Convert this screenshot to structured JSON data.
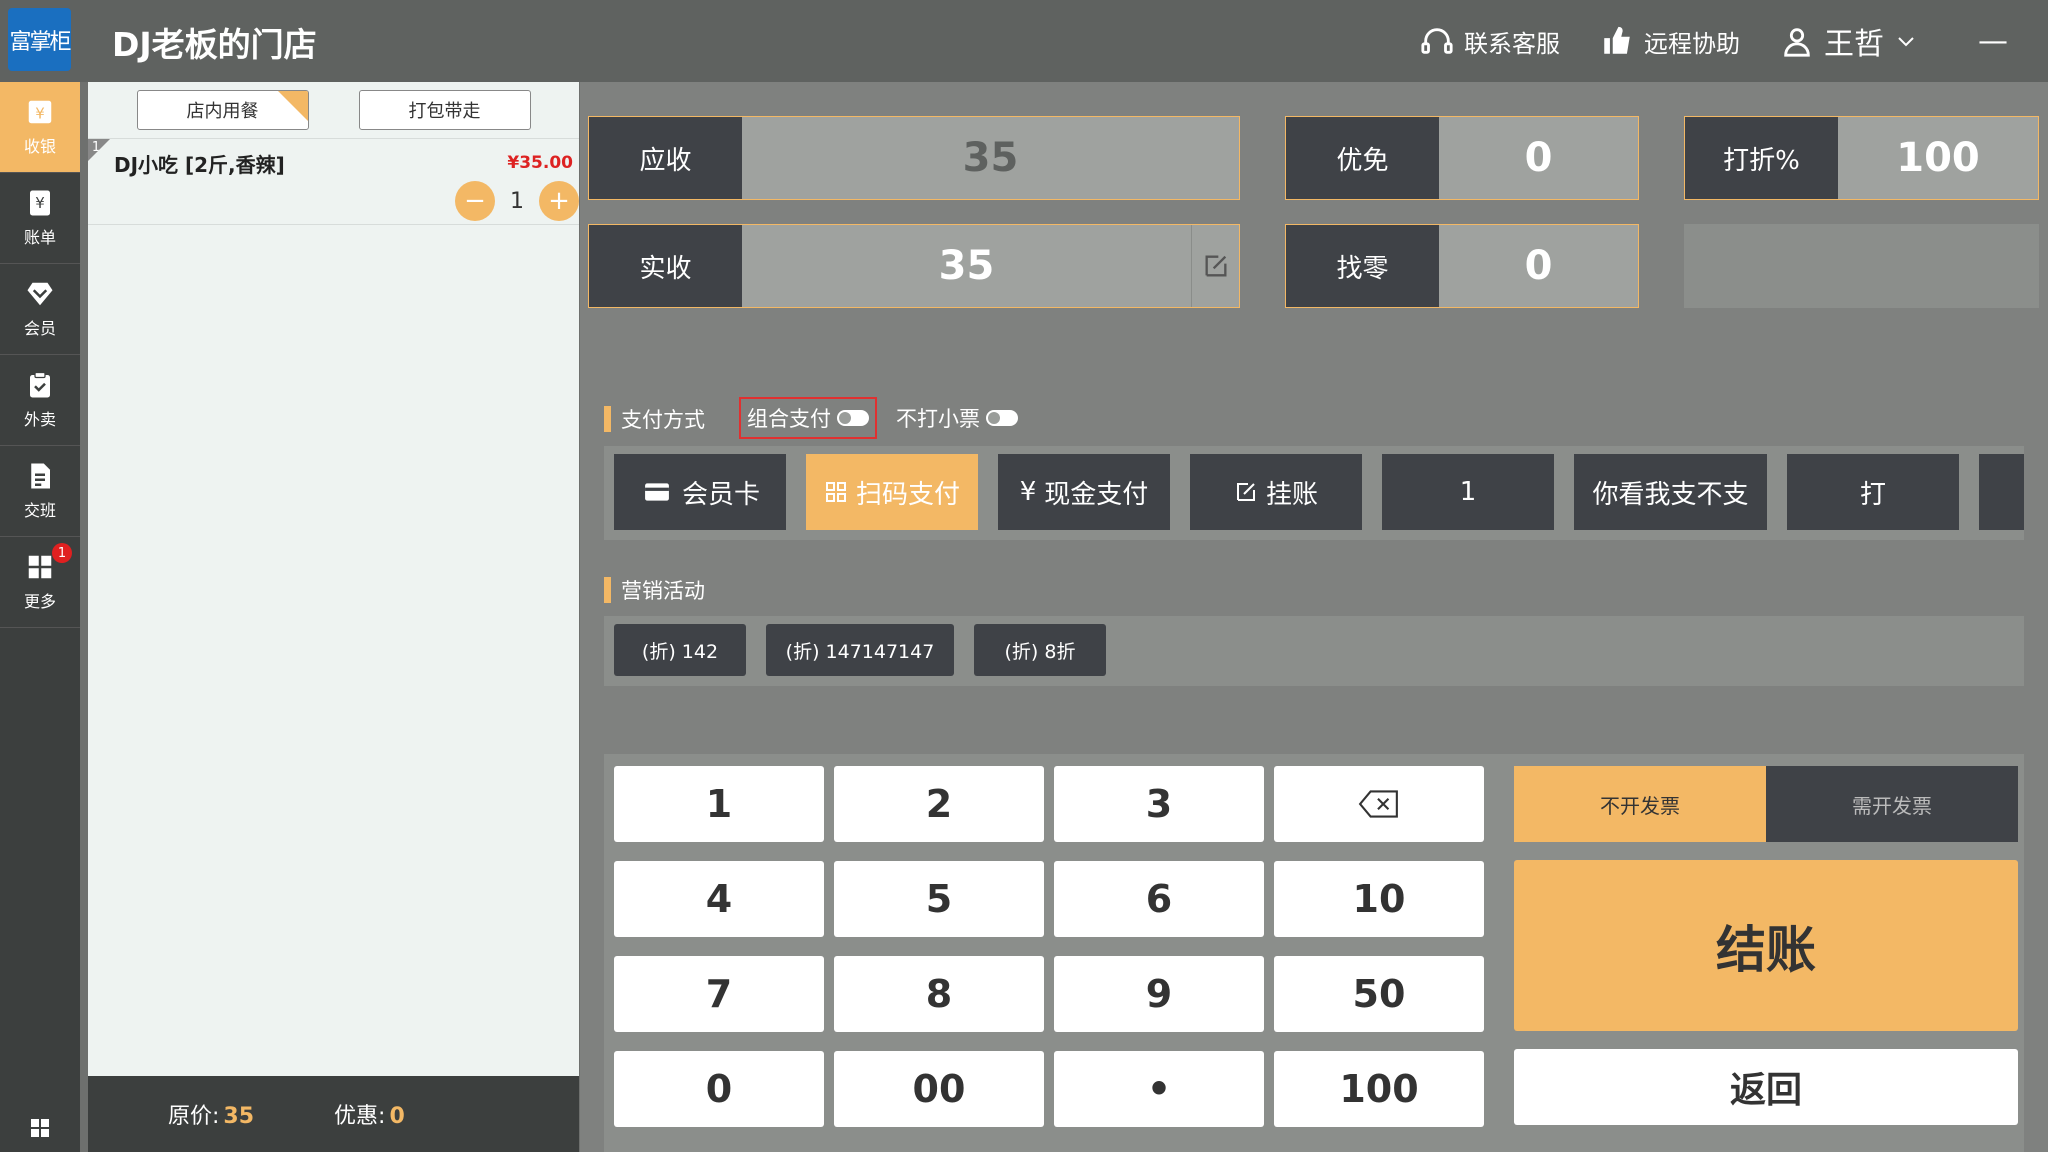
{
  "app": {
    "logo_text": "富掌柜",
    "store_name": "DJ老板的门店"
  },
  "header": {
    "customer_service": "联系客服",
    "remote_assist": "远程协助",
    "user_name": "王哲",
    "minimize": "—"
  },
  "sidebar": {
    "items": [
      {
        "label": "收银",
        "icon": "cashier-icon"
      },
      {
        "label": "账单",
        "icon": "bill-icon"
      },
      {
        "label": "会员",
        "icon": "member-icon"
      },
      {
        "label": "外卖",
        "icon": "takeout-icon"
      },
      {
        "label": "交班",
        "icon": "shift-icon"
      },
      {
        "label": "更多",
        "icon": "more-icon",
        "badge": "1"
      }
    ]
  },
  "order": {
    "tabs": [
      "店内用餐",
      "打包带走"
    ],
    "items": [
      {
        "index": "1",
        "name": "DJ小吃 [2斤,香辣]",
        "price": "¥35.00",
        "qty": "1",
        "minus": "−",
        "plus": "+"
      }
    ],
    "footer": {
      "original_label": "原价:",
      "original_value": "35",
      "discount_label": "优惠:",
      "discount_value": "0"
    }
  },
  "summary": {
    "receivable_label": "应收",
    "receivable_value": "35",
    "discount_label": "优免",
    "discount_value": "0",
    "rate_label": "打折%",
    "rate_value": "100",
    "received_label": "实收",
    "received_value": "35",
    "change_label": "找零",
    "change_value": "0"
  },
  "payment": {
    "title": "支付方式",
    "combo_label": "组合支付",
    "no_receipt_label": "不打小票",
    "methods": [
      "会员卡",
      "扫码支付",
      "现金支付",
      "挂账",
      "1",
      "你看我支不支",
      "打"
    ],
    "selected": "扫码支付"
  },
  "promotions": {
    "title": "营销活动",
    "items": [
      "(折) 142",
      "(折) 147147147",
      "(折) 8折"
    ]
  },
  "keypad": {
    "keys": [
      "1",
      "2",
      "3",
      "",
      "4",
      "5",
      "6",
      "10",
      "7",
      "8",
      "9",
      "50",
      "0",
      "00",
      "•",
      "100"
    ]
  },
  "invoice": {
    "no_invoice": "不开发票",
    "need_invoice": "需开发票"
  },
  "actions": {
    "checkout": "结账",
    "back": "返回"
  },
  "colors": {
    "accent": "#f3b865",
    "dark": "#3f4247",
    "price_red": "#dd2222"
  }
}
